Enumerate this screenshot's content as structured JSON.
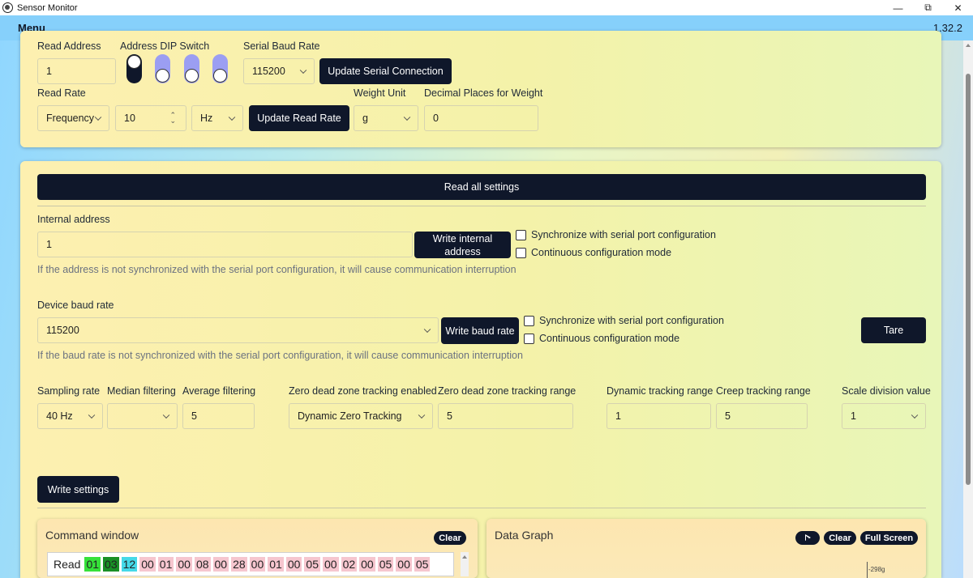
{
  "window": {
    "title": "Sensor Monitor",
    "minimize": "—",
    "restore": "⧉",
    "close": "✕"
  },
  "menubar": {
    "menu_label": "Menu",
    "version": "1.32.2"
  },
  "serial_panel": {
    "read_address_label": "Read Address",
    "read_address_value": "1",
    "dip_label": "Address DIP Switch",
    "dip_switches": [
      "on",
      "off",
      "off",
      "off"
    ],
    "baud_label": "Serial Baud Rate",
    "baud_value": "115200",
    "update_serial_button": "Update Serial Connection",
    "read_rate_label": "Read Rate",
    "read_rate_mode": "Frequency",
    "read_rate_value": "10",
    "read_rate_unit": "Hz",
    "update_read_rate_button": "Update Read Rate",
    "weight_unit_label": "Weight Unit",
    "weight_unit_value": "g",
    "decimal_places_label": "Decimal Places for Weight",
    "decimal_places_value": "0"
  },
  "settings_panel": {
    "read_all_button": "Read all settings",
    "internal_address_label": "Internal address",
    "internal_address_value": "1",
    "write_internal_button": "Write internal address",
    "sync_serial_label": "Synchronize with serial port configuration",
    "continuous_mode_label": "Continuous configuration mode",
    "address_hint": "If the address is not synchronized with the serial port configuration, it will cause communication interruption",
    "device_baud_label": "Device baud rate",
    "device_baud_value": "115200",
    "write_baud_button": "Write baud rate",
    "baud_sync_label": "Synchronize with serial port configuration",
    "baud_continuous_label": "Continuous configuration mode",
    "tare_button": "Tare",
    "baud_hint": "If the baud rate is not synchronized with the serial port configuration, it will cause communication interruption",
    "sampling_rate_label": "Sampling rate",
    "sampling_rate_value": "40 Hz",
    "median_filter_label": "Median filtering",
    "median_filter_value": "",
    "average_filter_label": "Average filtering",
    "average_filter_value": "5",
    "zero_tracking_label": "Zero dead zone tracking enabled",
    "zero_tracking_value": "Dynamic Zero Tracking",
    "zero_range_label": "Zero dead zone tracking range",
    "zero_range_value": "5",
    "dynamic_range_label": "Dynamic tracking range",
    "dynamic_range_value": "1",
    "creep_range_label": "Creep tracking range",
    "creep_range_value": "5",
    "scale_division_label": "Scale division value",
    "scale_division_value": "1",
    "write_settings_button": "Write settings"
  },
  "command_window": {
    "title": "Command window",
    "clear_button": "Clear",
    "row_label": "Read",
    "bytes": [
      "01",
      "03",
      "12",
      "00",
      "01",
      "00",
      "08",
      "00",
      "28",
      "00",
      "01",
      "00",
      "05",
      "00",
      "02",
      "00",
      "05",
      "00",
      "05"
    ]
  },
  "data_graph": {
    "title": "Data Graph",
    "clear_button": "Clear",
    "fullscreen_button": "Full Screen",
    "tick_label": "-298g"
  }
}
